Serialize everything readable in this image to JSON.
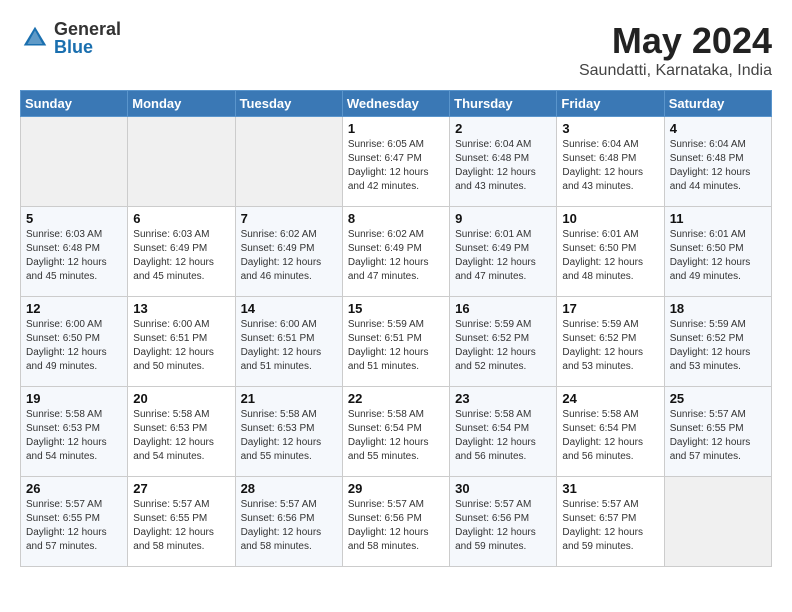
{
  "logo": {
    "general": "General",
    "blue": "Blue"
  },
  "header": {
    "title": "May 2024",
    "subtitle": "Saundatti, Karnataka, India"
  },
  "weekdays": [
    "Sunday",
    "Monday",
    "Tuesday",
    "Wednesday",
    "Thursday",
    "Friday",
    "Saturday"
  ],
  "weeks": [
    [
      {
        "day": "",
        "info": ""
      },
      {
        "day": "",
        "info": ""
      },
      {
        "day": "",
        "info": ""
      },
      {
        "day": "1",
        "info": "Sunrise: 6:05 AM\nSunset: 6:47 PM\nDaylight: 12 hours\nand 42 minutes."
      },
      {
        "day": "2",
        "info": "Sunrise: 6:04 AM\nSunset: 6:48 PM\nDaylight: 12 hours\nand 43 minutes."
      },
      {
        "day": "3",
        "info": "Sunrise: 6:04 AM\nSunset: 6:48 PM\nDaylight: 12 hours\nand 43 minutes."
      },
      {
        "day": "4",
        "info": "Sunrise: 6:04 AM\nSunset: 6:48 PM\nDaylight: 12 hours\nand 44 minutes."
      }
    ],
    [
      {
        "day": "5",
        "info": "Sunrise: 6:03 AM\nSunset: 6:48 PM\nDaylight: 12 hours\nand 45 minutes."
      },
      {
        "day": "6",
        "info": "Sunrise: 6:03 AM\nSunset: 6:49 PM\nDaylight: 12 hours\nand 45 minutes."
      },
      {
        "day": "7",
        "info": "Sunrise: 6:02 AM\nSunset: 6:49 PM\nDaylight: 12 hours\nand 46 minutes."
      },
      {
        "day": "8",
        "info": "Sunrise: 6:02 AM\nSunset: 6:49 PM\nDaylight: 12 hours\nand 47 minutes."
      },
      {
        "day": "9",
        "info": "Sunrise: 6:01 AM\nSunset: 6:49 PM\nDaylight: 12 hours\nand 47 minutes."
      },
      {
        "day": "10",
        "info": "Sunrise: 6:01 AM\nSunset: 6:50 PM\nDaylight: 12 hours\nand 48 minutes."
      },
      {
        "day": "11",
        "info": "Sunrise: 6:01 AM\nSunset: 6:50 PM\nDaylight: 12 hours\nand 49 minutes."
      }
    ],
    [
      {
        "day": "12",
        "info": "Sunrise: 6:00 AM\nSunset: 6:50 PM\nDaylight: 12 hours\nand 49 minutes."
      },
      {
        "day": "13",
        "info": "Sunrise: 6:00 AM\nSunset: 6:51 PM\nDaylight: 12 hours\nand 50 minutes."
      },
      {
        "day": "14",
        "info": "Sunrise: 6:00 AM\nSunset: 6:51 PM\nDaylight: 12 hours\nand 51 minutes."
      },
      {
        "day": "15",
        "info": "Sunrise: 5:59 AM\nSunset: 6:51 PM\nDaylight: 12 hours\nand 51 minutes."
      },
      {
        "day": "16",
        "info": "Sunrise: 5:59 AM\nSunset: 6:52 PM\nDaylight: 12 hours\nand 52 minutes."
      },
      {
        "day": "17",
        "info": "Sunrise: 5:59 AM\nSunset: 6:52 PM\nDaylight: 12 hours\nand 53 minutes."
      },
      {
        "day": "18",
        "info": "Sunrise: 5:59 AM\nSunset: 6:52 PM\nDaylight: 12 hours\nand 53 minutes."
      }
    ],
    [
      {
        "day": "19",
        "info": "Sunrise: 5:58 AM\nSunset: 6:53 PM\nDaylight: 12 hours\nand 54 minutes."
      },
      {
        "day": "20",
        "info": "Sunrise: 5:58 AM\nSunset: 6:53 PM\nDaylight: 12 hours\nand 54 minutes."
      },
      {
        "day": "21",
        "info": "Sunrise: 5:58 AM\nSunset: 6:53 PM\nDaylight: 12 hours\nand 55 minutes."
      },
      {
        "day": "22",
        "info": "Sunrise: 5:58 AM\nSunset: 6:54 PM\nDaylight: 12 hours\nand 55 minutes."
      },
      {
        "day": "23",
        "info": "Sunrise: 5:58 AM\nSunset: 6:54 PM\nDaylight: 12 hours\nand 56 minutes."
      },
      {
        "day": "24",
        "info": "Sunrise: 5:58 AM\nSunset: 6:54 PM\nDaylight: 12 hours\nand 56 minutes."
      },
      {
        "day": "25",
        "info": "Sunrise: 5:57 AM\nSunset: 6:55 PM\nDaylight: 12 hours\nand 57 minutes."
      }
    ],
    [
      {
        "day": "26",
        "info": "Sunrise: 5:57 AM\nSunset: 6:55 PM\nDaylight: 12 hours\nand 57 minutes."
      },
      {
        "day": "27",
        "info": "Sunrise: 5:57 AM\nSunset: 6:55 PM\nDaylight: 12 hours\nand 58 minutes."
      },
      {
        "day": "28",
        "info": "Sunrise: 5:57 AM\nSunset: 6:56 PM\nDaylight: 12 hours\nand 58 minutes."
      },
      {
        "day": "29",
        "info": "Sunrise: 5:57 AM\nSunset: 6:56 PM\nDaylight: 12 hours\nand 58 minutes."
      },
      {
        "day": "30",
        "info": "Sunrise: 5:57 AM\nSunset: 6:56 PM\nDaylight: 12 hours\nand 59 minutes."
      },
      {
        "day": "31",
        "info": "Sunrise: 5:57 AM\nSunset: 6:57 PM\nDaylight: 12 hours\nand 59 minutes."
      },
      {
        "day": "",
        "info": ""
      }
    ]
  ]
}
